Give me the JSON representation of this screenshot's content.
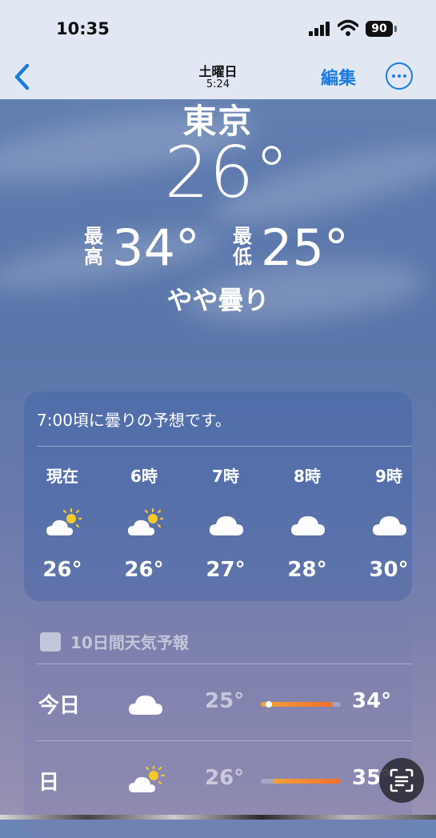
{
  "status_bar": {
    "time": "10:35",
    "battery": "90"
  },
  "nav": {
    "day": "土曜日",
    "time": "5:24",
    "edit_label": "編集"
  },
  "hero": {
    "city": "東京",
    "current_temp": "26°",
    "high_label": "最高",
    "high": "34°",
    "low_label": "最低",
    "low": "25°",
    "condition": "やや曇り"
  },
  "hourly": {
    "summary": "7:00頃に曇りの予想です。",
    "items": [
      {
        "label": "現在",
        "icon": "partly-sunny-icon",
        "temp": "26°"
      },
      {
        "label": "6時",
        "icon": "partly-sunny-icon",
        "temp": "26°"
      },
      {
        "label": "7時",
        "icon": "cloud-icon",
        "temp": "27°"
      },
      {
        "label": "8時",
        "icon": "cloud-icon",
        "temp": "28°"
      },
      {
        "label": "9時",
        "icon": "cloud-icon",
        "temp": "30°"
      }
    ]
  },
  "daily": {
    "title": "10日間天気予報",
    "rows": [
      {
        "day": "今日",
        "icon": "cloud-icon",
        "low": "25°",
        "high": "34°",
        "range_start": 0.0,
        "range_end": 0.9,
        "current": 0.1
      },
      {
        "day": "日",
        "icon": "partly-sunny-icon",
        "low": "26°",
        "high": "35°",
        "range_start": 0.15,
        "range_end": 1.0
      }
    ]
  },
  "colors": {
    "accent": "#1a7ae0",
    "range_start": "#f2a33b",
    "range_end": "#f26f2a"
  }
}
